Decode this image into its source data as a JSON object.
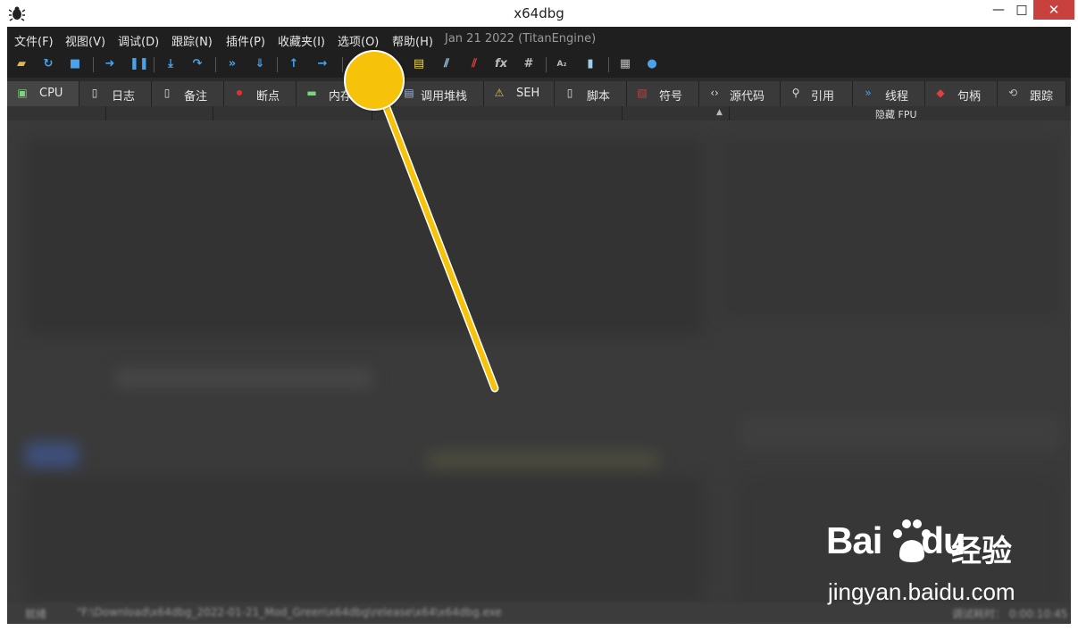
{
  "window": {
    "title": "x64dbg",
    "close_symbol": "✕",
    "max_symbol": "□",
    "min_symbol": "—"
  },
  "menu": {
    "items": [
      "文件(F)",
      "视图(V)",
      "调试(D)",
      "跟踪(N)",
      "插件(P)",
      "收藏夹(I)",
      "选项(O)",
      "帮助(H)"
    ],
    "build_info": "Jan 21 2022 (TitanEngine)"
  },
  "toolbar": {
    "icons": [
      "open-icon",
      "restart-icon",
      "stop-icon",
      "run-icon",
      "pause-icon",
      "step-into-icon",
      "step-over-icon",
      "trace-into-icon",
      "trace-over-icon",
      "execute-till-return-icon",
      "run-to-user-code-icon",
      "scylla-icon",
      "patch-icon",
      "comments-icon",
      "labels-icon",
      "bookmarks-icon",
      "functions-icon",
      "variables-icon",
      "strings-icon",
      "calculator-icon",
      "help-icon"
    ]
  },
  "tabs": [
    {
      "label": "CPU",
      "icon": "cpu-icon",
      "active": true
    },
    {
      "label": "日志",
      "icon": "log-icon"
    },
    {
      "label": "备注",
      "icon": "notes-icon"
    },
    {
      "label": "断点",
      "icon": "breakpoint-icon"
    },
    {
      "label": "内存",
      "icon": "memory-icon"
    },
    {
      "label": "调用堆栈",
      "icon": "callstack-icon"
    },
    {
      "label": "SEH",
      "icon": "seh-icon"
    },
    {
      "label": "脚本",
      "icon": "script-icon"
    },
    {
      "label": "符号",
      "icon": "symbol-icon"
    },
    {
      "label": "源代码",
      "icon": "source-icon"
    },
    {
      "label": "引用",
      "icon": "references-icon"
    },
    {
      "label": "线程",
      "icon": "threads-icon"
    },
    {
      "label": "句柄",
      "icon": "handles-icon"
    },
    {
      "label": "跟踪",
      "icon": "trace-icon"
    }
  ],
  "register_panel": {
    "fpu_toggle": "隐藏 FPU"
  },
  "status_bar": {
    "state": "就绪",
    "path": "\"F:\\Download\\x64dbg_2022-01-21_Mod_Green\\x64dbg\\release\\x64\\x64dbg.exe",
    "time": "调试耗时： 0:00:10:45"
  },
  "watermark": {
    "brand": "Bai",
    "brand_end": "du",
    "brand_cn": "经验",
    "url": "jingyan.baidu.com"
  },
  "colors": {
    "highlight": "#f7c20a",
    "close_button": "#c8413e",
    "menubar": "#1f1f1f"
  }
}
